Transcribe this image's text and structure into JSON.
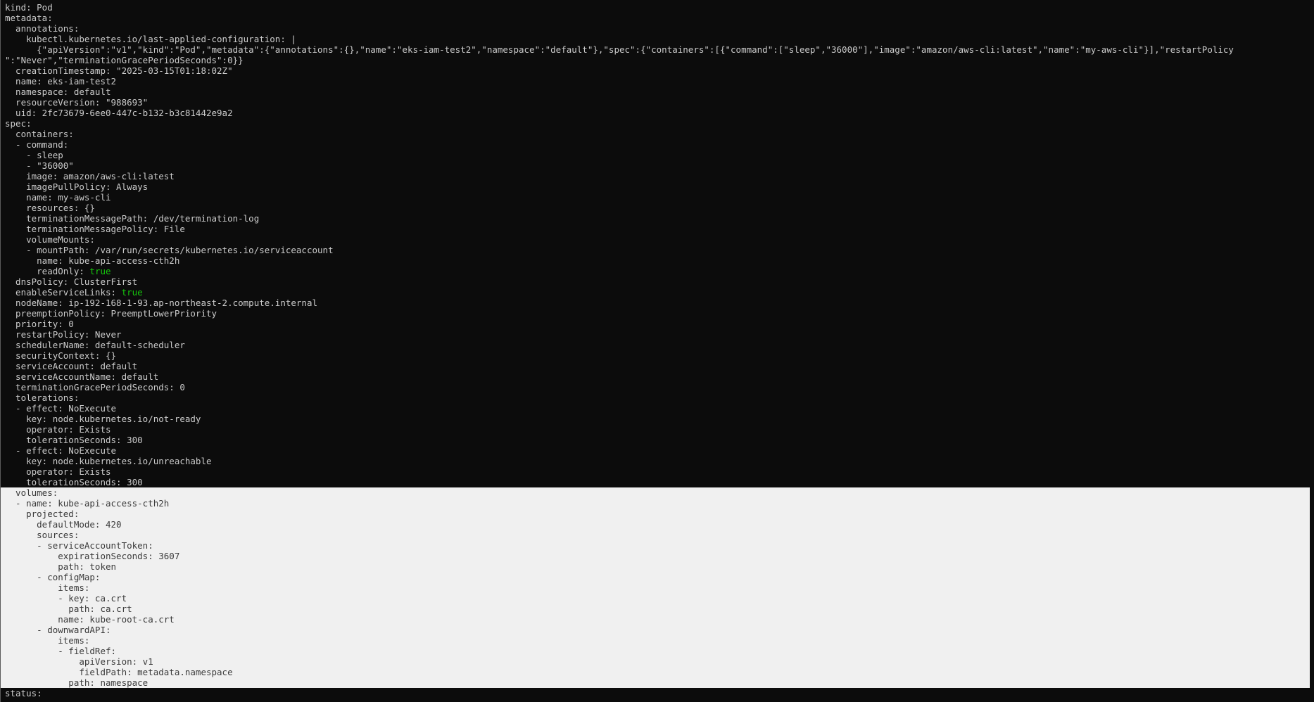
{
  "terminal": {
    "lines": [
      {
        "text": "kind: Pod"
      },
      {
        "text": "metadata:"
      },
      {
        "text": "  annotations:"
      },
      {
        "text": "    kubectl.kubernetes.io/last-applied-configuration: |"
      },
      {
        "text": "      {\"apiVersion\":\"v1\",\"kind\":\"Pod\",\"metadata\":{\"annotations\":{},\"name\":\"eks-iam-test2\",\"namespace\":\"default\"},\"spec\":{\"containers\":[{\"command\":[\"sleep\",\"36000\"],\"image\":\"amazon/aws-cli:latest\",\"name\":\"my-aws-cli\"}],\"restartPolicy"
      },
      {
        "text": "\":\"Never\",\"terminationGracePeriodSeconds\":0}}"
      },
      {
        "text": "  creationTimestamp: \"2025-03-15T01:18:02Z\""
      },
      {
        "text": "  name: eks-iam-test2"
      },
      {
        "text": "  namespace: default"
      },
      {
        "text": "  resourceVersion: \"988693\""
      },
      {
        "text": "  uid: 2fc73679-6ee0-447c-b132-b3c81442e9a2"
      },
      {
        "text": "spec:"
      },
      {
        "text": "  containers:"
      },
      {
        "text": "  - command:"
      },
      {
        "text": "    - sleep"
      },
      {
        "text": "    - \"36000\""
      },
      {
        "text": "    image: amazon/aws-cli:latest"
      },
      {
        "text": "    imagePullPolicy: Always"
      },
      {
        "text": "    name: my-aws-cli"
      },
      {
        "text": "    resources: {}"
      },
      {
        "text": "    terminationMessagePath: /dev/termination-log"
      },
      {
        "text": "    terminationMessagePolicy: File"
      },
      {
        "text": "    volumeMounts:"
      },
      {
        "text": "    - mountPath: /var/run/secrets/kubernetes.io/serviceaccount"
      },
      {
        "text": "      name: kube-api-access-cth2h"
      },
      {
        "text": "      readOnly: ",
        "tail": "true"
      },
      {
        "text": "  dnsPolicy: ClusterFirst"
      },
      {
        "text": "  enableServiceLinks: ",
        "tail": "true"
      },
      {
        "text": "  nodeName: ip-192-168-1-93.ap-northeast-2.compute.internal"
      },
      {
        "text": "  preemptionPolicy: PreemptLowerPriority"
      },
      {
        "text": "  priority: 0"
      },
      {
        "text": "  restartPolicy: Never"
      },
      {
        "text": "  schedulerName: default-scheduler"
      },
      {
        "text": "  securityContext: {}"
      },
      {
        "text": "  serviceAccount: default"
      },
      {
        "text": "  serviceAccountName: default"
      },
      {
        "text": "  terminationGracePeriodSeconds: 0"
      },
      {
        "text": "  tolerations:"
      },
      {
        "text": "  - effect: NoExecute"
      },
      {
        "text": "    key: node.kubernetes.io/not-ready"
      },
      {
        "text": "    operator: Exists"
      },
      {
        "text": "    tolerationSeconds: 300"
      },
      {
        "text": "  - effect: NoExecute"
      },
      {
        "text": "    key: node.kubernetes.io/unreachable"
      },
      {
        "text": "    operator: Exists"
      },
      {
        "text": "    tolerationSeconds: 300"
      },
      {
        "text": "  volumes:",
        "selected": true
      },
      {
        "text": "  - name: kube-api-access-cth2h",
        "selected": true
      },
      {
        "text": "    projected:",
        "selected": true
      },
      {
        "text": "      defaultMode: 420",
        "selected": true
      },
      {
        "text": "      sources:",
        "selected": true
      },
      {
        "text": "      - serviceAccountToken:",
        "selected": true
      },
      {
        "text": "          expirationSeconds: 3607",
        "selected": true
      },
      {
        "text": "          path: token",
        "selected": true
      },
      {
        "text": "      - configMap:",
        "selected": true
      },
      {
        "text": "          items:",
        "selected": true
      },
      {
        "text": "          - key: ca.crt",
        "selected": true
      },
      {
        "text": "            path: ca.crt",
        "selected": true
      },
      {
        "text": "          name: kube-root-ca.crt",
        "selected": true
      },
      {
        "text": "      - downwardAPI:",
        "selected": true
      },
      {
        "text": "          items:",
        "selected": true
      },
      {
        "text": "          - fieldRef:",
        "selected": true
      },
      {
        "text": "              apiVersion: v1",
        "selected": true
      },
      {
        "text": "              fieldPath: metadata.namespace",
        "selected": true
      },
      {
        "text": "            path: namespace",
        "selected": true
      },
      {
        "text": "status:"
      }
    ]
  },
  "colors": {
    "background": "#0c0c0c",
    "foreground": "#cccccc",
    "boolean": "#16c60c",
    "selection_bg": "#f0f0f0",
    "selection_fg": "#3a3a3a"
  }
}
